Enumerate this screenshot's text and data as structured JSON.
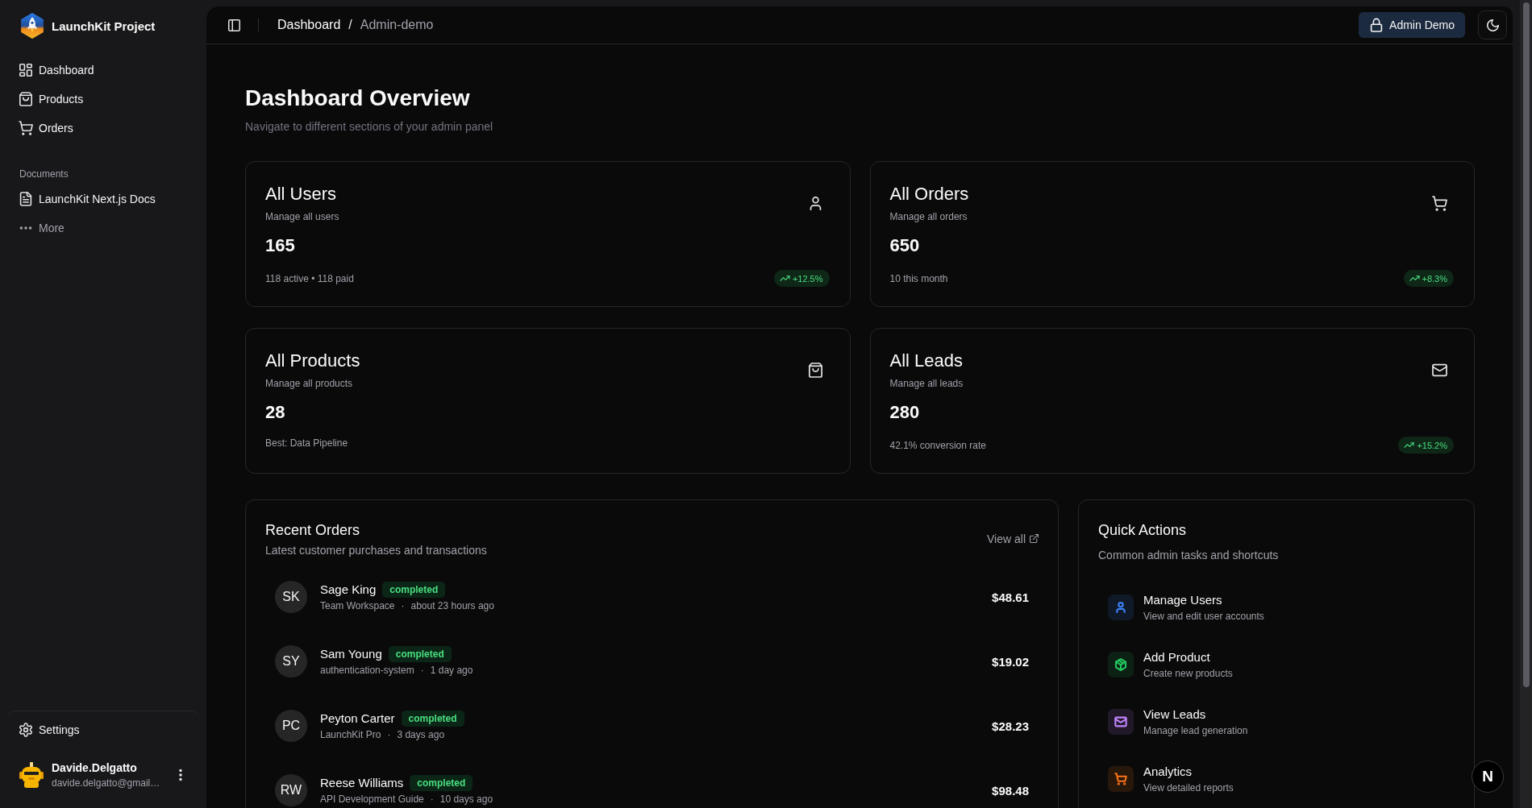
{
  "sidebar": {
    "brand": {
      "name": "LaunchKit Project"
    },
    "nav_items": [
      {
        "label": "Dashboard"
      },
      {
        "label": "Products"
      },
      {
        "label": "Orders"
      }
    ],
    "documents": {
      "heading": "Documents",
      "items": [
        {
          "label": "LaunchKit Next.js Docs",
          "kind": "link"
        },
        {
          "label": "More",
          "kind": "more"
        }
      ]
    },
    "settings": {
      "label": "Settings"
    },
    "user": {
      "name": "Davide.Delgatto",
      "email": "davide.delgatto@gmail…"
    }
  },
  "header": {
    "breadcrumb": [
      {
        "label": "Dashboard",
        "current": false
      },
      {
        "label": "Admin-demo",
        "current": true
      }
    ],
    "separator": "/",
    "admin_button": {
      "label": "Admin Demo"
    }
  },
  "page": {
    "title": "Dashboard Overview",
    "subtitle": "Navigate to different sections of your admin panel"
  },
  "stat_cards": [
    {
      "title": "All Users",
      "subtitle": "Manage all users",
      "value": "165",
      "footer": "118 active • 118 paid",
      "trend": "+12.5%"
    },
    {
      "title": "All Orders",
      "subtitle": "Manage all orders",
      "value": "650",
      "footer": "10 this month",
      "trend": "+8.3%"
    },
    {
      "title": "All Products",
      "subtitle": "Manage all products",
      "value": "28",
      "footer": "Best: Data Pipeline"
    },
    {
      "title": "All Leads",
      "subtitle": "Manage all leads",
      "value": "280",
      "footer": "42.1% conversion rate",
      "trend": "+15.2%"
    }
  ],
  "recent_orders": {
    "title": "Recent Orders",
    "subtitle": "Latest customer purchases and transactions",
    "view_all": "View all",
    "orders": [
      {
        "initials": "SK",
        "name": "Sage King",
        "status": "completed",
        "product": "Team Workspace",
        "separator": "·",
        "time": "about 23 hours ago",
        "amount": "$48.61"
      },
      {
        "initials": "SY",
        "name": "Sam Young",
        "status": "completed",
        "product": "authentication-system",
        "separator": "·",
        "time": "1 day ago",
        "amount": "$19.02"
      },
      {
        "initials": "PC",
        "name": "Peyton Carter",
        "status": "completed",
        "product": "LaunchKit Pro",
        "separator": "·",
        "time": "3 days ago",
        "amount": "$28.23"
      },
      {
        "initials": "RW",
        "name": "Reese Williams",
        "status": "completed",
        "product": "API Development Guide",
        "separator": "·",
        "time": "10 days ago",
        "amount": "$98.48"
      }
    ]
  },
  "quick_actions": {
    "title": "Quick Actions",
    "subtitle": "Common admin tasks and shortcuts",
    "actions": [
      {
        "title": "Manage Users",
        "description": "View and edit user accounts",
        "color": "#3b82f6"
      },
      {
        "title": "Add Product",
        "description": "Create new products",
        "color": "#22c55e"
      },
      {
        "title": "View Leads",
        "description": "Manage lead generation",
        "color": "#c084fc"
      },
      {
        "title": "Analytics",
        "description": "View detailed reports",
        "color": "#f97316"
      }
    ]
  },
  "dev_tools_button": {
    "label": "N"
  }
}
